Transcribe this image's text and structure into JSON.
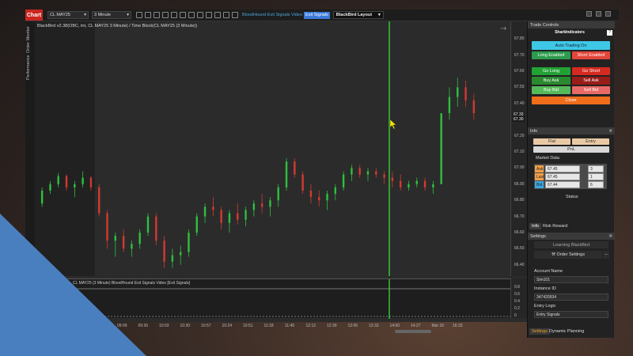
{
  "toolbar": {
    "chart_tab": "Chart",
    "instrument": "CL MAY25",
    "interval": "3 Minute",
    "exit_signals_label": "BloodHound Exit Signals Video",
    "exit_signals_button": "Exit Signals",
    "layout": "BlackBird Layout"
  },
  "left_tabs": {
    "monitor": "Order Monitor",
    "performance": "Performance"
  },
  "chart": {
    "title": "BlackBird v2.38(OBC, tnt, CL MAY25 3 Minute) / Time Block(CL MAY25 (3 Minute))",
    "price_labels": [
      "67.80",
      "67.70",
      "67.60",
      "67.50",
      "67.40",
      "67.30",
      "67.20",
      "67.10",
      "67.00",
      "66.90",
      "66.80",
      "66.70",
      "66.60",
      "66.50",
      "66.40"
    ],
    "current_price_tags": [
      "67.33",
      "67.30"
    ],
    "sub_title": "CL MAY25 (3 Minute) BloodHound Exit Signals Video  [Exit Signals]",
    "sub_labels": [
      "0.8",
      "0.6",
      "0.4",
      "0.2",
      "0"
    ],
    "time_labels": [
      "09:09",
      "09:36",
      "10:03",
      "10:30",
      "10:57",
      "10:24",
      "10:51",
      "11:18",
      "11:45",
      "12:12",
      "12:39",
      "13:06",
      "13:33",
      "14:00",
      "14:27",
      "Mar 16",
      "16:33"
    ],
    "chart_data": {
      "type": "candlestick",
      "ylim": [
        66.35,
        67.85
      ],
      "candles": [
        [
          66.78,
          66.88,
          66.76,
          66.86
        ],
        [
          66.86,
          66.92,
          66.84,
          66.9
        ],
        [
          66.9,
          66.97,
          66.88,
          66.95
        ],
        [
          66.95,
          66.96,
          66.86,
          66.88
        ],
        [
          66.88,
          66.92,
          66.82,
          66.9
        ],
        [
          66.9,
          66.98,
          66.88,
          66.94
        ],
        [
          66.94,
          66.95,
          66.86,
          66.88
        ],
        [
          66.88,
          66.9,
          66.7,
          66.72
        ],
        [
          66.72,
          66.74,
          66.5,
          66.55
        ],
        [
          66.55,
          66.6,
          66.45,
          66.58
        ],
        [
          66.58,
          66.62,
          66.48,
          66.5
        ],
        [
          66.5,
          66.55,
          66.45,
          66.53
        ],
        [
          66.53,
          66.62,
          66.5,
          66.6
        ],
        [
          66.6,
          66.72,
          66.58,
          66.7
        ],
        [
          66.7,
          66.72,
          66.52,
          66.55
        ],
        [
          66.55,
          66.58,
          66.38,
          66.42
        ],
        [
          66.42,
          66.5,
          66.38,
          66.46
        ],
        [
          66.46,
          66.52,
          66.4,
          66.48
        ],
        [
          66.48,
          66.62,
          66.45,
          66.6
        ],
        [
          66.6,
          66.72,
          66.58,
          66.7
        ],
        [
          66.7,
          66.78,
          66.66,
          66.76
        ],
        [
          66.76,
          66.82,
          66.7,
          66.74
        ],
        [
          66.74,
          66.76,
          66.62,
          66.66
        ],
        [
          66.66,
          66.74,
          66.6,
          66.72
        ],
        [
          66.72,
          66.78,
          66.65,
          66.68
        ],
        [
          66.68,
          66.76,
          66.64,
          66.74
        ],
        [
          66.74,
          66.8,
          66.7,
          66.78
        ],
        [
          66.78,
          66.84,
          66.72,
          66.76
        ],
        [
          66.76,
          66.82,
          66.7,
          66.8
        ],
        [
          66.8,
          66.9,
          66.76,
          66.88
        ],
        [
          66.88,
          67.06,
          66.86,
          67.04
        ],
        [
          67.04,
          67.06,
          66.94,
          66.96
        ],
        [
          66.96,
          66.98,
          66.84,
          66.86
        ],
        [
          66.86,
          66.9,
          66.78,
          66.82
        ],
        [
          66.82,
          66.86,
          66.76,
          66.8
        ],
        [
          66.8,
          66.86,
          66.74,
          66.84
        ],
        [
          66.84,
          66.9,
          66.8,
          66.88
        ],
        [
          66.88,
          66.98,
          66.86,
          66.96
        ],
        [
          66.96,
          67.02,
          66.92,
          67.0
        ],
        [
          67.0,
          67.02,
          66.94,
          66.96
        ],
        [
          66.96,
          67.0,
          66.92,
          66.98
        ],
        [
          66.98,
          67.0,
          66.94,
          66.96
        ],
        [
          66.96,
          66.98,
          66.9,
          66.94
        ],
        [
          66.94,
          66.98,
          66.88,
          66.92
        ],
        [
          66.92,
          66.96,
          66.86,
          66.88
        ],
        [
          66.88,
          66.92,
          66.86,
          66.9
        ],
        [
          66.9,
          66.94,
          66.88,
          66.92
        ],
        [
          66.92,
          66.94,
          66.86,
          66.88
        ],
        [
          66.88,
          66.92,
          66.84,
          66.9
        ],
        [
          66.9,
          67.12,
          66.9,
          67.34
        ],
        [
          67.34,
          67.5,
          67.3,
          67.44
        ],
        [
          67.44,
          67.56,
          67.38,
          67.5
        ],
        [
          67.5,
          67.54,
          67.38,
          67.42
        ],
        [
          67.42,
          67.46,
          67.3,
          67.34
        ]
      ]
    }
  },
  "side": {
    "trade_controls": "Trade Controls",
    "logo": "SharkIndicators",
    "auto_trading": "Auto Trading On",
    "long_enabled": "Long Enabled",
    "short_enabled": "Short Enabled",
    "go_long": "Go Long",
    "go_short": "Go Short",
    "buy_ask": "Buy Ask",
    "sell_ask": "Sell Ask",
    "buy_bid": "Buy Bid",
    "sell_bid": "Sell Bid",
    "close": "Close",
    "info": "Info",
    "flat": "Flat",
    "entry": "Entry",
    "pnl": "PnL",
    "market_data": "Market Data",
    "ask_label": "Ask",
    "ask_price": "67.45",
    "ask_size": "3",
    "last_label": "Last",
    "last_price": "67.45",
    "last_size": "1",
    "bid_label": "Bid",
    "bid_price": "67.44",
    "bid_size": "6",
    "status": "Status",
    "tab_info": "Info",
    "tab_risk": "Risk Reward",
    "settings": "Settings",
    "learning": "Learning BlackBird",
    "order_settings": "Order Settings",
    "account_name_label": "Account Name",
    "account_name": "Sim101",
    "instance_label": "Instance ID",
    "instance_id": "347420934",
    "entry_logic_label": "Entry Logic",
    "entry_logic": "Entry Signals",
    "tab_settings": "Settings",
    "tab_dynamic": "Dynamic Planning"
  },
  "colors": {
    "accent_red": "#c8261e",
    "up": "#2fbf3f",
    "down": "#d23a32",
    "cyan_btn": "#3fc7e6",
    "panel_blue": "#3a74b4"
  }
}
